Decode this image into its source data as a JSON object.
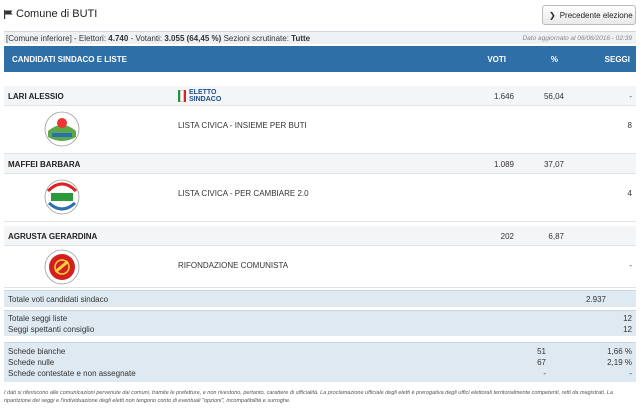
{
  "header": {
    "title": "Comune di BUTI",
    "prev_button": "Precedente elezione"
  },
  "info": {
    "comune_inferiore": "[Comune inferiore]",
    "elettori_label": "- Elettori:",
    "elettori": "4.740",
    "votanti_label": "- Votanti:",
    "votanti": "3.055",
    "votanti_pct": "(64,45 %)",
    "sezioni_label": "Sezioni scrutinate:",
    "sezioni": "Tutte",
    "updated": "Dato aggiornato al 06/06/2016 - 02:39"
  },
  "table_header": {
    "candidates": "CANDIDATI SINDACO E LISTE",
    "votes": "VOTI",
    "pct": "%",
    "seats": "SEGGI"
  },
  "elected_badge": {
    "line1": "ELETTO",
    "line2": "SINDACO"
  },
  "candidates": [
    {
      "name": "LARI ALESSIO",
      "votes": "1.646",
      "pct": "56,04",
      "seats": "-",
      "elected": true,
      "list": {
        "name": "LISTA CIVICA - INSIEME PER BUTI",
        "seats": "8",
        "logo_icon": "insieme-per-buti-logo-icon"
      }
    },
    {
      "name": "MAFFEI BARBARA",
      "votes": "1.089",
      "pct": "37,07",
      "seats": "-",
      "elected": false,
      "list": {
        "name": "LISTA CIVICA - PER CAMBIARE 2.0",
        "seats": "4",
        "logo_icon": "per-cambiare-logo-icon"
      }
    },
    {
      "name": "AGRUSTA GERARDINA",
      "votes": "202",
      "pct": "6,87",
      "seats": "-",
      "elected": false,
      "list": {
        "name": "RIFONDAZIONE COMUNISTA",
        "seats": "-",
        "logo_icon": "rifondazione-comunista-logo-icon"
      }
    }
  ],
  "totals": {
    "voti_sindaco_label": "Totale voti candidati sindaco",
    "voti_sindaco": "2.937",
    "seggi_liste_label": "Totale seggi liste",
    "seggi_liste": "12",
    "seggi_consiglio_label": "Seggi spettanti consiglio",
    "seggi_consiglio": "12",
    "bianche_label": "Schede bianche",
    "bianche": "51",
    "bianche_pct": "1,66 %",
    "nulle_label": "Schede nulle",
    "nulle": "67",
    "nulle_pct": "2,19 %",
    "contestate_label": "Schede contestate e non assegnate",
    "contestate": "-",
    "contestate_pct": "-"
  },
  "footnote": "I dati si riferiscono alle comunicazioni pervenute dai comuni, tramite le prefetture, e non rivestono, pertanto, carattere di ufficialità. La proclamazione ufficiale degli eletti è prerogativa degli uffici elettorali territorialmente competenti, retti da magistrati. La ripartizione dei seggi e l'individuazione degli eletti non tengono conto di eventuali \"opzioni\", incompatibilità e surroghe.",
  "colors": {
    "header_blue": "#2d6fa6",
    "summary_blue": "#dfe9f2",
    "elected_text": "#1a4f8a"
  }
}
